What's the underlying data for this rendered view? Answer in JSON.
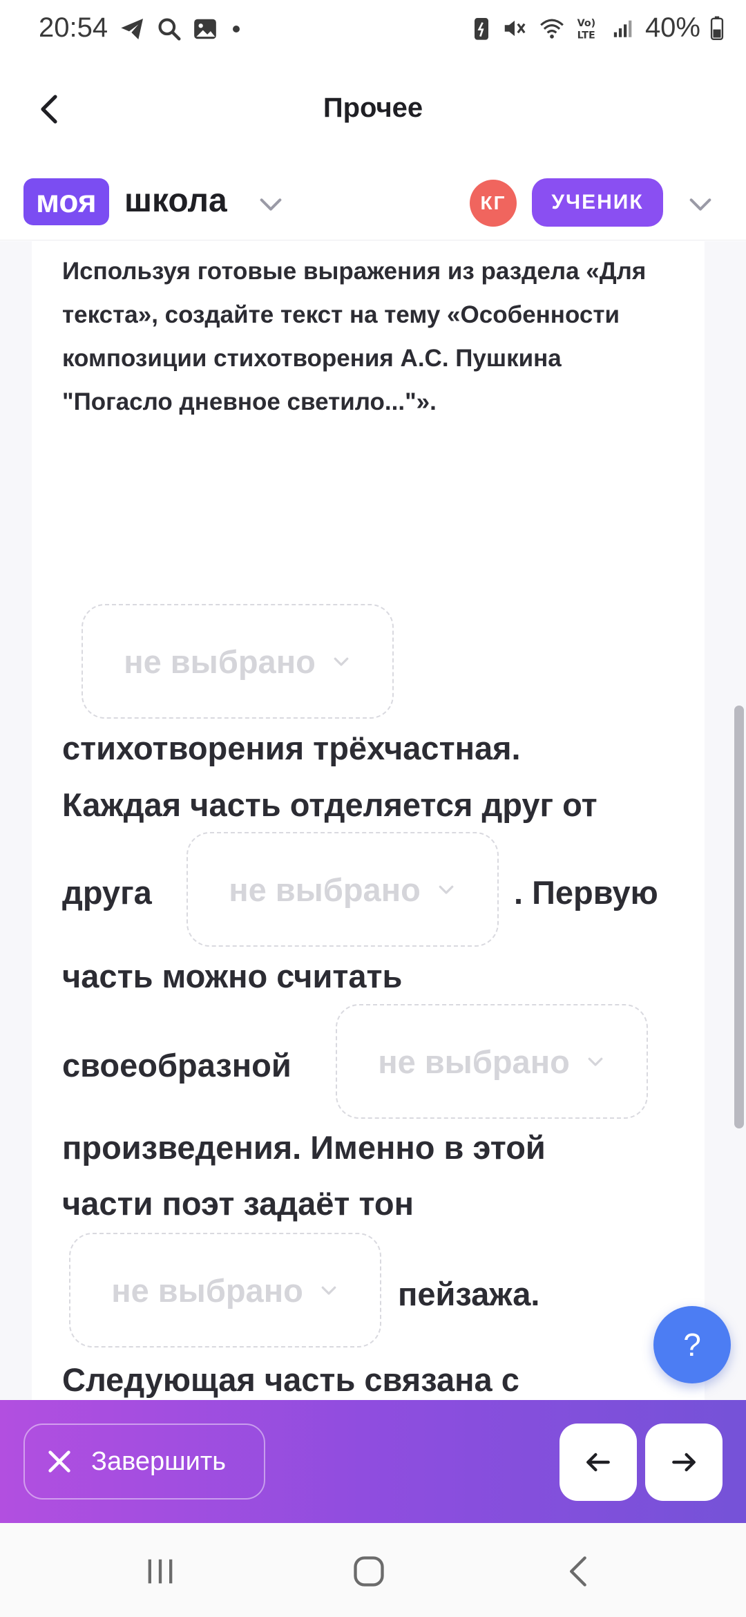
{
  "status_bar": {
    "time": "20:54",
    "left_icons": [
      "telegram-icon",
      "search-icon",
      "gallery-icon",
      "dot-icon"
    ],
    "right_icons": [
      "battery-saver-icon",
      "mute-icon",
      "wifi-icon",
      "volte-icon",
      "signal-icon",
      "battery-icon"
    ],
    "battery_percent": "40%"
  },
  "header": {
    "title": "Прочее",
    "back_icon": "chevron-left-icon"
  },
  "brand": {
    "logo_part1": "моя",
    "logo_part2": "школа",
    "accent_color": "#7b4df2",
    "avatar_initials": "КГ",
    "role": "УЧЕНИК"
  },
  "task": {
    "instruction": "Используя готовые выражения из раздела «Для текста», создайте текст на тему «Особенности композиции стихотворения А.С. Пушкина \"Погасло дневное светило...\"».",
    "dropdown_placeholder": "не выбрано",
    "fragments": {
      "f1": "стихотворения трёхчастная.",
      "f2": "Каждая часть отделяется друг от",
      "f3": "друга",
      "f4": ". Первую",
      "f5": "часть можно считать",
      "f6": "своеобразной",
      "f7": "произведения. Именно в этой",
      "f8": "части поэт задаёт тон",
      "f9": "пейзажа.",
      "f10": "Следующая часть связана с"
    }
  },
  "help_button": {
    "label": "?"
  },
  "bottom_bar": {
    "finish_label": "Завершить",
    "finish_icon": "close-icon",
    "prev_icon": "arrow-left-icon",
    "next_icon": "arrow-right-icon"
  },
  "system_nav": {
    "icons": [
      "recent-apps-icon",
      "home-icon",
      "back-icon"
    ]
  }
}
